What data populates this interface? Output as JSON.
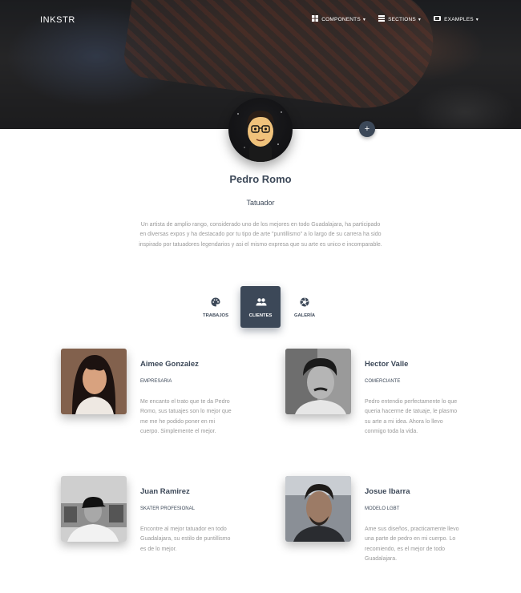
{
  "navbar": {
    "brand": "INKSTR",
    "items": [
      {
        "label": "COMPONENTS",
        "icon": "palette-grid-icon"
      },
      {
        "label": "SECTIONS",
        "icon": "layers-icon"
      },
      {
        "label": "EXAMPLES",
        "icon": "window-icon"
      }
    ]
  },
  "profile": {
    "fab_label": "+",
    "name": "Pedro Romo",
    "role": "Tatuador",
    "bio": "Un artista de amplio rango, considerado uno de los mejores en todo Guadalajara, ha participado en diversas expos y ha destacado por tu tipo de arte \"puntillismo\" a lo largo de su carrera ha sido inspirado por tatuadores legendarios y asi el mismo expresa que su arte es unico e incomparable."
  },
  "tabs": [
    {
      "label": "TRABAJOS",
      "icon": "palette-icon",
      "active": false
    },
    {
      "label": "CLIENTES",
      "icon": "people-icon",
      "active": true
    },
    {
      "label": "GALERÍA",
      "icon": "camera-aperture-icon",
      "active": false
    }
  ],
  "clients": [
    {
      "name": "Aimee Gonzalez",
      "title": "EMPRESARIA",
      "quote": "Me encanto el trato que te da Pedro Romo, sus tatuajes son lo mejor que me me he podido poner en mi cuerpo. Simplemente el mejor."
    },
    {
      "name": "Hector Valle",
      "title": "COMERCIANTE",
      "quote": "Pedro entendio perfectamente lo que queria hacerme de tatuaje, le plasmo su arte a mi idea. Ahora lo llevo conmigo toda la vida."
    },
    {
      "name": "Juan Ramirez",
      "title": "SKATER PROFESIONAL",
      "quote": "Encontre al mejor tatuador en todo Guadalajara, su estilo de puntillismo es de lo mejor."
    },
    {
      "name": "Josue Ibarra",
      "title": "MODELO LGBT",
      "quote": "Ame sus diseños, practicamente llevo una parte de pedro en mi cuerpo. Lo recomiendo, es el mejor de todo Guadalajara."
    }
  ],
  "colors": {
    "primary": "#3c4858",
    "muted_text": "#999999"
  }
}
